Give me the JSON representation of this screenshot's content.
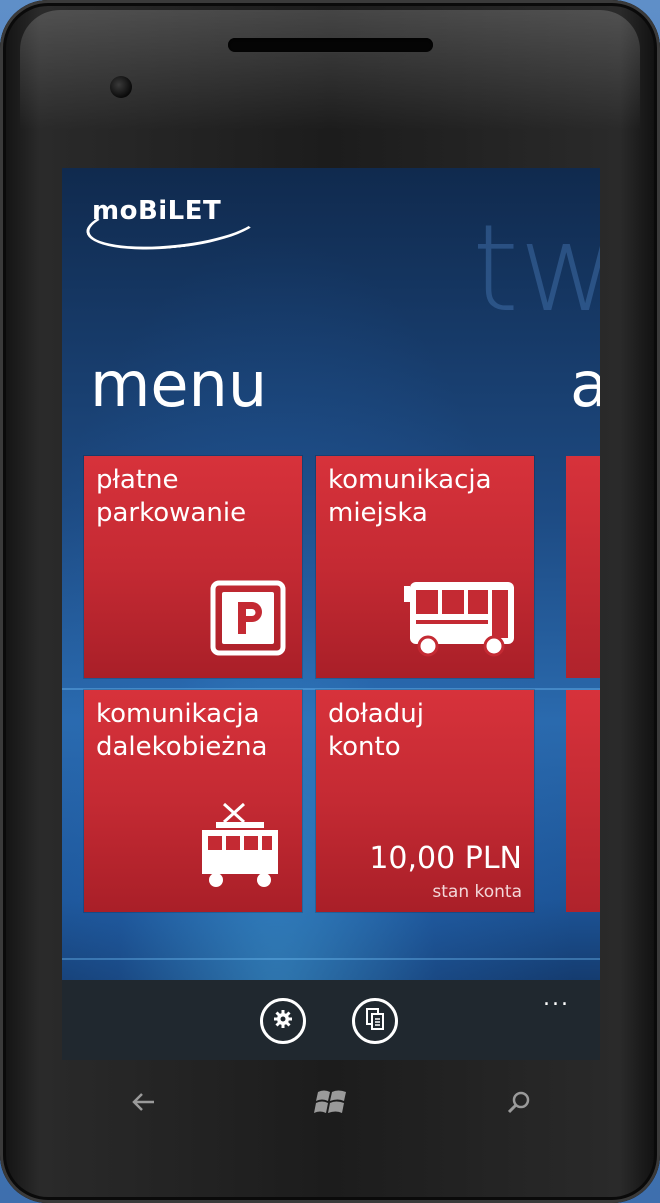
{
  "app": {
    "logo_text": "moBiLET",
    "background_word": "tw",
    "section_title": "menu",
    "next_section_title": "a"
  },
  "tiles": [
    {
      "label": "płatne\nparkowanie",
      "icon": "parking-icon"
    },
    {
      "label": "komunikacja\nmiejska",
      "icon": "bus-icon"
    },
    {
      "label": "komunikacja\ndalekobieżna",
      "icon": "train-icon"
    },
    {
      "label": "doładuj\nkonto",
      "amount": "10,00 PLN",
      "sub": "stan konta"
    }
  ],
  "app_bar": {
    "buttons": [
      "settings-icon",
      "tickets-icon"
    ],
    "more": "..."
  },
  "hardware_keys": [
    "back-icon",
    "windows-start-icon",
    "search-icon"
  ],
  "colors": {
    "tile_red": "#d7323b",
    "screen_blue": "#1d4a82",
    "app_bar": "#20282f"
  }
}
